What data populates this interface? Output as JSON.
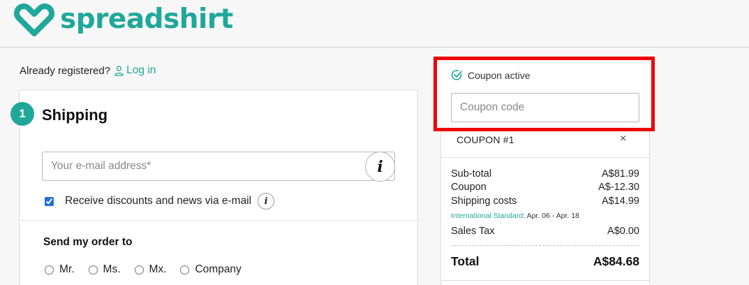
{
  "brand": {
    "name": "spreadshirt",
    "color": "#1fa89a"
  },
  "login": {
    "prompt": "Already registered?",
    "link_label": "Log in"
  },
  "shipping": {
    "step_number": "1",
    "title": "Shipping",
    "email_placeholder": "Your e-mail address*",
    "info_glyph": "i",
    "newsletter_label": "Receive discounts and news via e-mail",
    "newsletter_checked": true,
    "send_title": "Send my order to",
    "salutations": [
      "Mr.",
      "Ms.",
      "Mx.",
      "Company"
    ]
  },
  "coupon": {
    "status": "Coupon active",
    "placeholder": "Coupon code",
    "applied": "COUPON #1",
    "remove_glyph": "×"
  },
  "summary": {
    "subtotal_label": "Sub-total",
    "subtotal_value": "A$81.99",
    "coupon_label": "Coupon",
    "coupon_value": "A$-12.30",
    "shipping_label": "Shipping costs",
    "shipping_value": "A$14.99",
    "shipping_method": "International Standard",
    "shipping_dates": ": Apr. 06 - Apr. 18",
    "tax_label": "Sales Tax",
    "tax_value": "A$0.00",
    "total_label": "Total",
    "total_value": "A$84.68"
  },
  "highlight_color": "#ee0000"
}
